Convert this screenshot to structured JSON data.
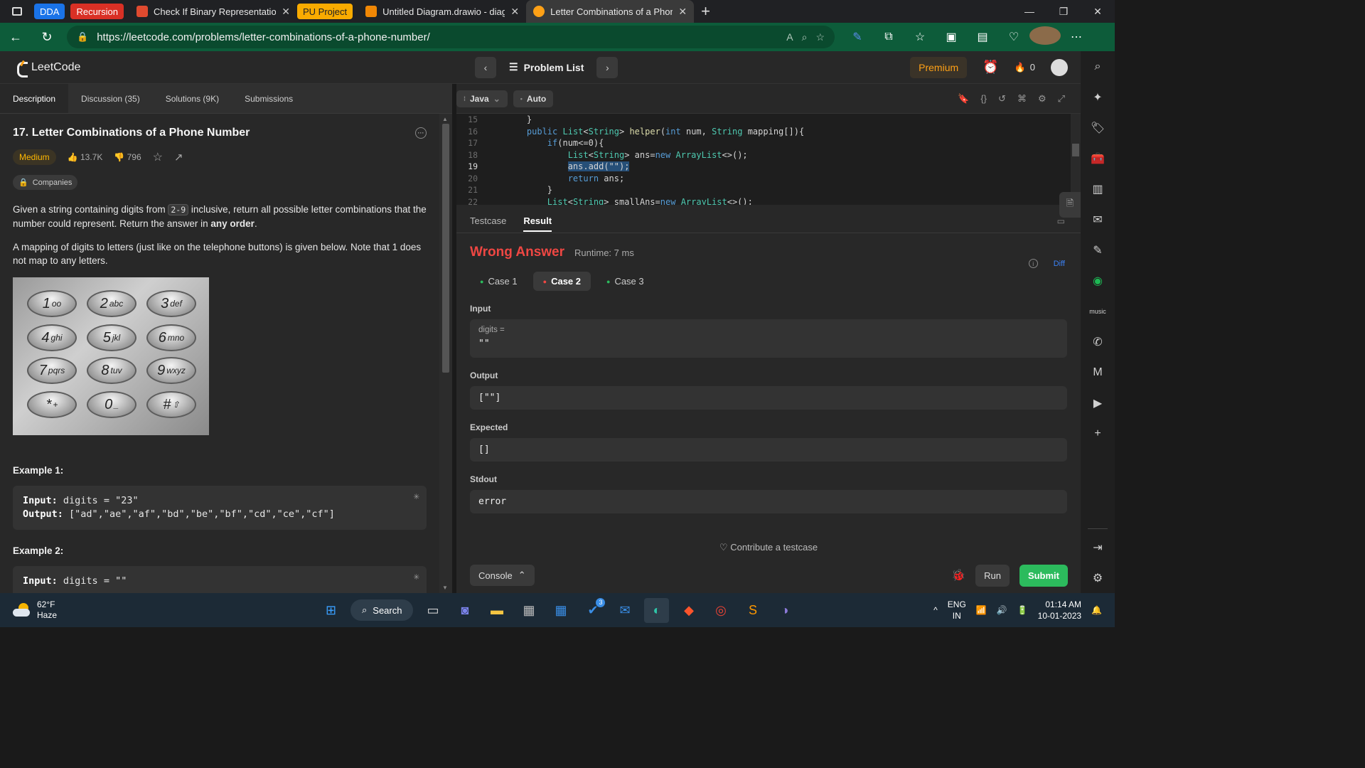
{
  "browser": {
    "pinned_tabs": [
      {
        "label": "DDA",
        "color": "#1a73e8"
      },
      {
        "label": "Recursion",
        "color": "#d93025"
      }
    ],
    "tabs": [
      {
        "title": "Check If Binary Representation o",
        "icon": "red-tab-favicon"
      },
      {
        "title": "Untitled Diagram.drawio - diagra",
        "icon": "drawio-favicon"
      },
      {
        "title": "Letter Combinations of a Phone",
        "icon": "leetcode-favicon",
        "active": true
      }
    ],
    "pinned_mid": {
      "label": "PU Project",
      "color": "#f9ab00"
    },
    "url": "https://leetcode.com/problems/letter-combinations-of-a-phone-number/"
  },
  "leetcode": {
    "logo_text": "LeetCode",
    "problem_list_label": "Problem List",
    "premium_label": "Premium",
    "streak": "0",
    "left_tabs": [
      "Description",
      "Discussion (35)",
      "Solutions (9K)",
      "Submissions"
    ],
    "title": "17. Letter Combinations of a Phone Number",
    "difficulty": "Medium",
    "likes": "13.7K",
    "dislikes": "796",
    "companies_label": "Companies",
    "desc": {
      "p1_a": "Given a string containing digits from ",
      "p1_code": "2-9",
      "p1_b": " inclusive, return all possible letter combinations that the number could represent. Return the answer in ",
      "p1_bold": "any order",
      "p1_c": ".",
      "p2": "A mapping of digits to letters (just like on the telephone buttons) is given below. Note that 1 does not map to any letters."
    },
    "keypad": [
      {
        "d": "1",
        "l": "oo"
      },
      {
        "d": "2",
        "l": "abc"
      },
      {
        "d": "3",
        "l": "def"
      },
      {
        "d": "4",
        "l": "ghi"
      },
      {
        "d": "5",
        "l": "jkl"
      },
      {
        "d": "6",
        "l": "mno"
      },
      {
        "d": "7",
        "l": "pqrs"
      },
      {
        "d": "8",
        "l": "tuv"
      },
      {
        "d": "9",
        "l": "wxyz"
      },
      {
        "d": "*",
        "l": "+"
      },
      {
        "d": "0",
        "l": "_"
      },
      {
        "d": "#",
        "l": "⇧"
      }
    ],
    "example1": {
      "heading": "Example 1:",
      "input_label": "Input:",
      "input": "digits = \"23\"",
      "output_label": "Output:",
      "output": "[\"ad\",\"ae\",\"af\",\"bd\",\"be\",\"bf\",\"cd\",\"ce\",\"cf\"]"
    },
    "example2": {
      "heading": "Example 2:",
      "input_label": "Input:",
      "input": "digits = \"\""
    }
  },
  "editor": {
    "language": "Java",
    "mode": "Auto",
    "lines": [
      {
        "n": "15",
        "code": "    }"
      },
      {
        "n": "16",
        "code": "    public List<String> helper(int num, String mapping[]){"
      },
      {
        "n": "17",
        "code": "        if(num<=0){"
      },
      {
        "n": "18",
        "code": "            List<String> ans=new ArrayList<>();"
      },
      {
        "n": "19",
        "code": "            ans.add(\"\");",
        "current": true
      },
      {
        "n": "20",
        "code": "            return ans;"
      },
      {
        "n": "21",
        "code": "        }"
      },
      {
        "n": "22",
        "code": "        List<String> smallAns=new ArrayList<>();"
      }
    ]
  },
  "result": {
    "tabs": [
      "Testcase",
      "Result"
    ],
    "active_tab": "Result",
    "verdict": "Wrong Answer",
    "verdict_color": "#ef4743",
    "runtime": "Runtime: 7 ms",
    "diff_label": "Diff",
    "cases": [
      {
        "label": "Case 1",
        "status": "pass"
      },
      {
        "label": "Case 2",
        "status": "fail",
        "active": true
      },
      {
        "label": "Case 3",
        "status": "pass"
      }
    ],
    "input_label": "Input",
    "input_var": "digits =",
    "input_value": "\"\"",
    "output_label": "Output",
    "output_value": "[\"\"]",
    "expected_label": "Expected",
    "expected_value": "[]",
    "stdout_label": "Stdout",
    "stdout_value": "error",
    "contribute_label": "Contribute a testcase",
    "console_label": "Console",
    "run_label": "Run",
    "submit_label": "Submit",
    "submit_color": "#2cbb5d"
  },
  "taskbar": {
    "temperature": "62°F",
    "weather": "Haze",
    "search_label": "Search",
    "lang_top": "ENG",
    "lang_bottom": "IN",
    "time": "01:14 AM",
    "date": "10-01-2023",
    "badge": "3"
  }
}
